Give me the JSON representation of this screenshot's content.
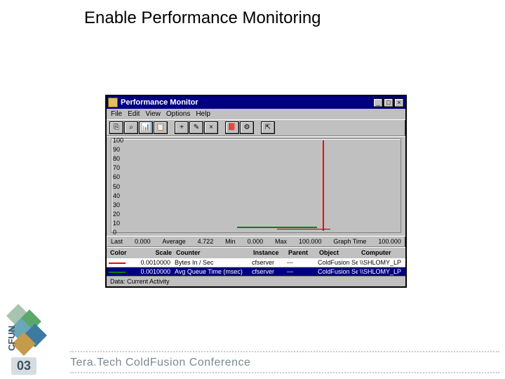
{
  "slide": {
    "title": "Enable Performance Monitoring"
  },
  "window": {
    "title": "Performance Monitor",
    "menu": [
      "File",
      "Edit",
      "View",
      "Options",
      "Help"
    ],
    "button_min": "_",
    "button_max": "□",
    "button_close": "×"
  },
  "toolbar": {
    "btn0": "⎘",
    "btn1": "⌕",
    "btn2": "📊",
    "btn3": "📋",
    "btn_plus": "+",
    "btn_edit": "✎",
    "btn_del": "×",
    "btn_book": "📕",
    "btn_opts": "⚙",
    "btn_exp": "⇱"
  },
  "chart_data": {
    "type": "line",
    "ylim": [
      0,
      100
    ],
    "yticks": [
      100,
      90,
      80,
      70,
      60,
      50,
      40,
      30,
      20,
      10,
      0
    ],
    "series": [
      {
        "name": "Bytes In / Sec",
        "color": "#ff0000",
        "values_near_zero": true
      },
      {
        "name": "Avg Queue Time (msec)",
        "color": "#008000",
        "values_near_zero": true
      }
    ],
    "current_time_marker_pct": 72
  },
  "stats": {
    "last_label": "Last",
    "last_value": "0.000",
    "avg_label": "Average",
    "avg_value": "4.722",
    "min_label": "Min",
    "min_value": "0.000",
    "max_label": "Max",
    "max_value": "100.000",
    "graph_label": "Graph Time",
    "graph_value": "100.000"
  },
  "table": {
    "headers": {
      "color": "Color",
      "scale": "Scale",
      "counter": "Counter",
      "instance": "Instance",
      "parent": "Parent",
      "object": "Object",
      "computer": "Computer"
    },
    "rows": [
      {
        "color": "#ff0000",
        "scale": "0.0010000",
        "counter": "Bytes In / Sec",
        "instance": "cfserver",
        "parent": "---",
        "object": "ColdFusion Server",
        "computer": "\\\\SHLOMY_LP",
        "selected": false
      },
      {
        "color": "#008000",
        "scale": "0.0010000",
        "counter": "Avg Queue Time (msec)",
        "instance": "cfserver",
        "parent": "---",
        "object": "ColdFusion Server",
        "computer": "\\\\SHLOMY_LP",
        "selected": true
      }
    ]
  },
  "statusbar": {
    "text": "Data: Current Activity"
  },
  "branding": {
    "cfun": "CFUN",
    "year": "03",
    "conference": "Tera.Tech ColdFusion Conference"
  }
}
